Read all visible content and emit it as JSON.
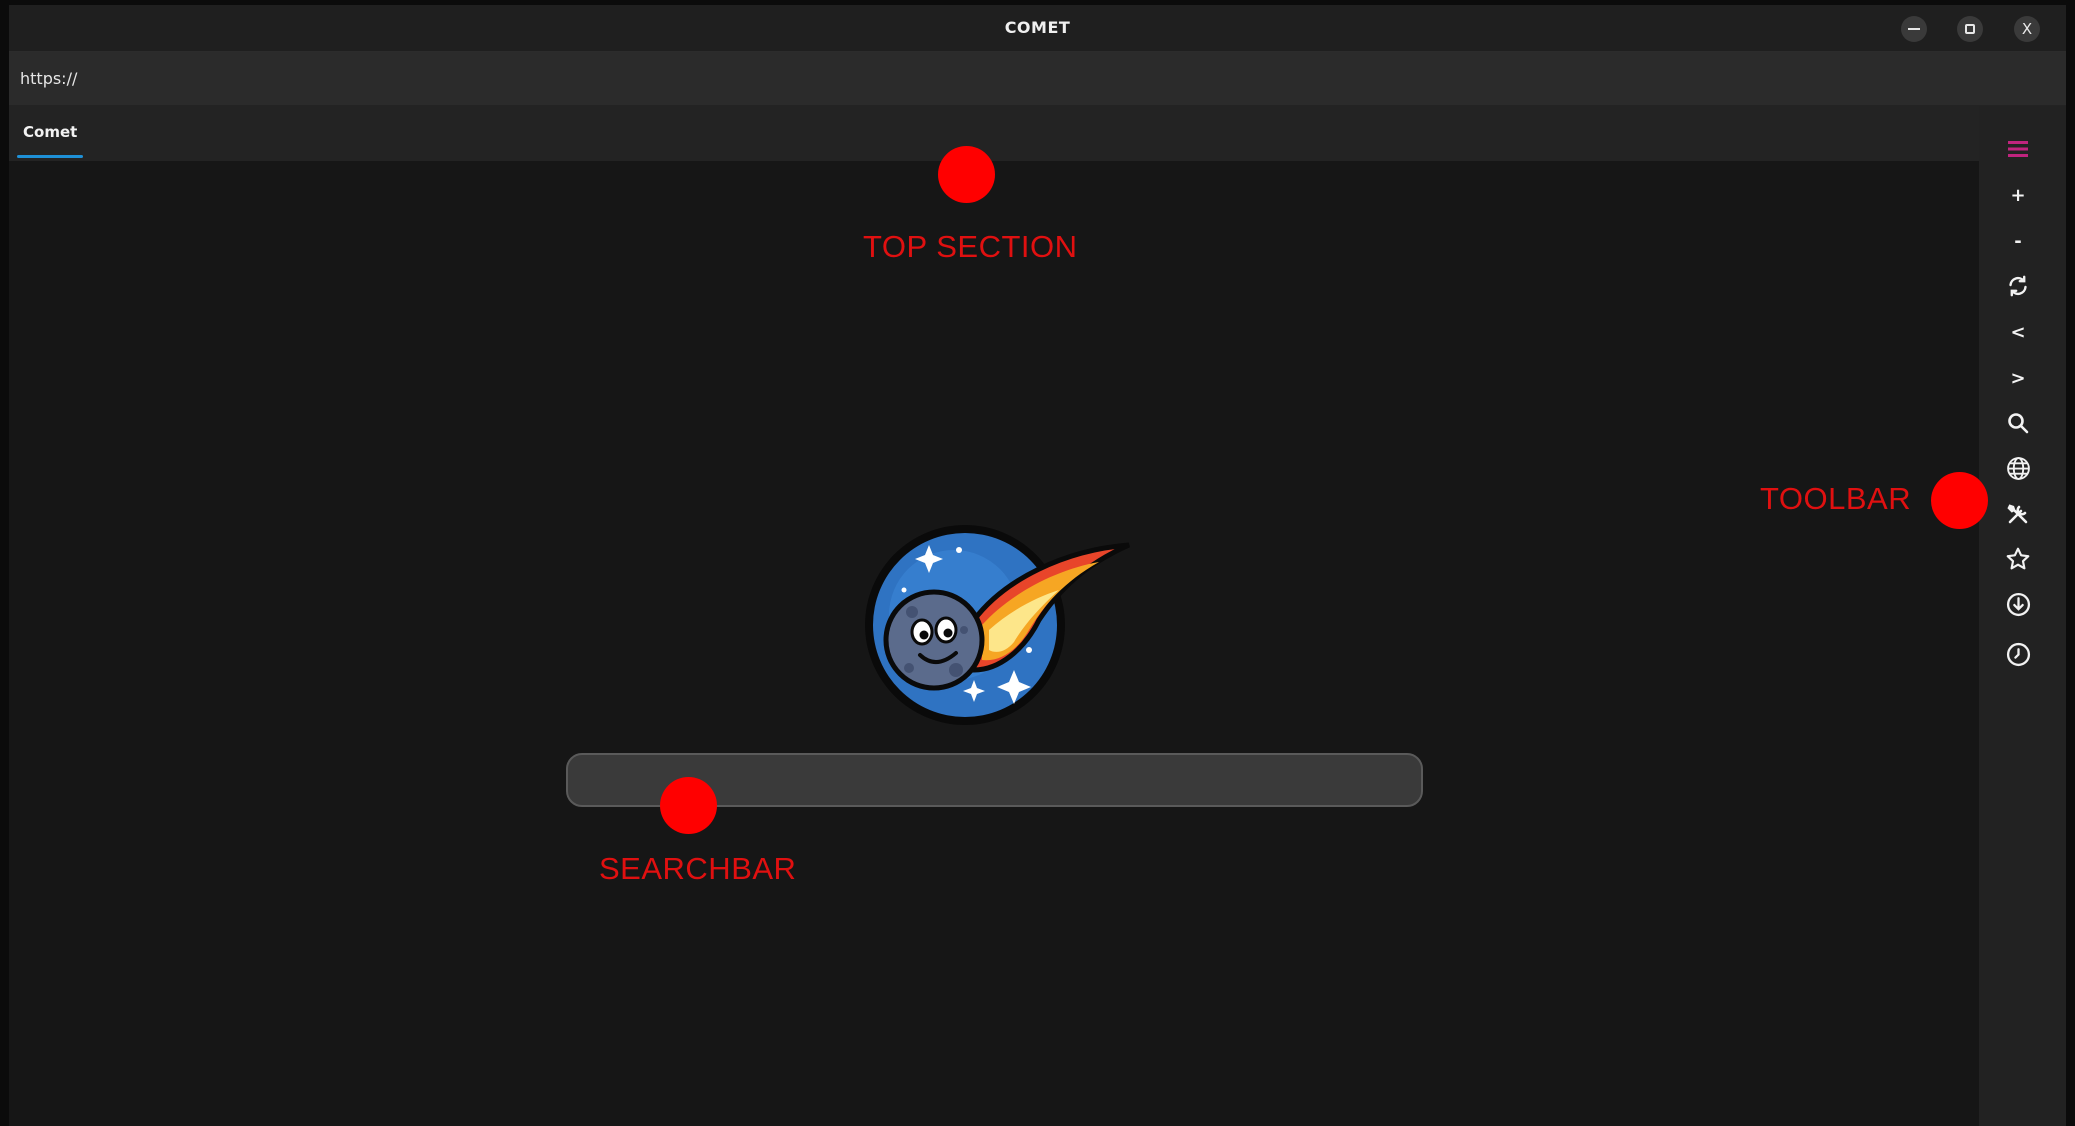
{
  "window": {
    "title": "COMET",
    "close_label": "X"
  },
  "url_bar": {
    "value": "https://"
  },
  "tabs": [
    {
      "label": "Comet",
      "active": true
    }
  ],
  "toolbar": {
    "items": [
      {
        "name": "menu",
        "icon": "hamburger-icon",
        "color": "#c0247e"
      },
      {
        "name": "zoom-in",
        "label": "+"
      },
      {
        "name": "zoom-out",
        "label": "-"
      },
      {
        "name": "reload",
        "icon": "refresh-icon"
      },
      {
        "name": "back",
        "label": "<"
      },
      {
        "name": "forward",
        "label": ">"
      },
      {
        "name": "search",
        "icon": "search-icon"
      },
      {
        "name": "web",
        "icon": "globe-icon"
      },
      {
        "name": "tools",
        "icon": "tools-icon"
      },
      {
        "name": "bookmarks",
        "icon": "star-icon"
      },
      {
        "name": "downloads",
        "icon": "download-icon"
      },
      {
        "name": "history",
        "icon": "clock-icon"
      }
    ]
  },
  "search": {
    "value": "",
    "placeholder": ""
  },
  "annotations": {
    "top_section": "TOP SECTION",
    "toolbar": "TOOLBAR",
    "searchbar": "SEARCHBAR",
    "color": "#ff0000"
  }
}
